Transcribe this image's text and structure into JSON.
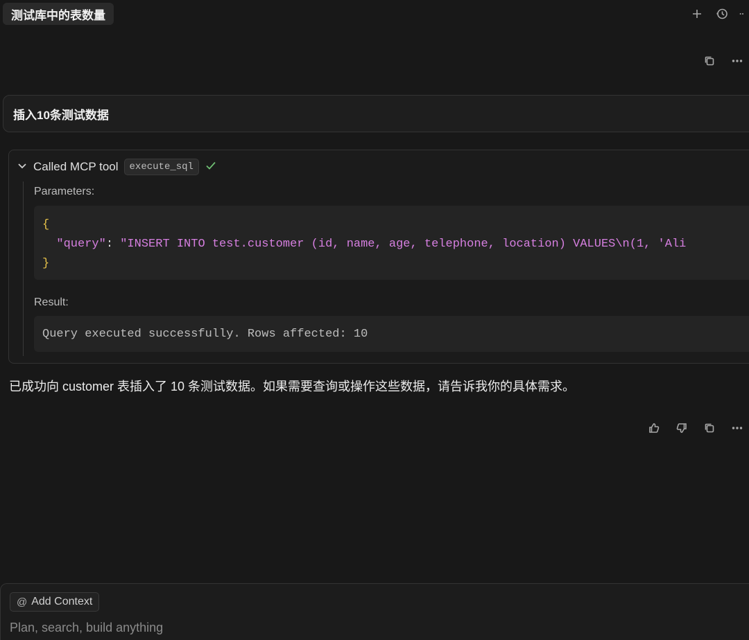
{
  "tab": {
    "title": "测试库中的表数量"
  },
  "top_icons": [
    "plus-icon",
    "history-icon",
    "more-icon"
  ],
  "user_message": {
    "text": "插入10条测试数据"
  },
  "tool_call": {
    "header_label": "Called MCP tool",
    "tool_name": "execute_sql",
    "status": "success",
    "parameters_label": "Parameters:",
    "params": {
      "open_brace": "{",
      "key": "\"query\"",
      "colon": ": ",
      "value": "\"INSERT INTO test.customer (id, name, age, telephone, location) VALUES\\n(1, 'Ali",
      "close_brace": "}"
    },
    "result_label": "Result:",
    "result_text": "Query executed successfully. Rows affected: 10"
  },
  "assistant_message": {
    "text": "已成功向 customer 表插入了 10 条测试数据。如果需要查询或操作这些数据，请告诉我你的具体需求。"
  },
  "composer": {
    "add_context_label": "Add Context",
    "placeholder": "Plan, search, build anything"
  },
  "colors": {
    "background": "#181818",
    "json_key": "#d67fe0",
    "json_brace": "#e8c34a",
    "success": "#6fbf73"
  }
}
